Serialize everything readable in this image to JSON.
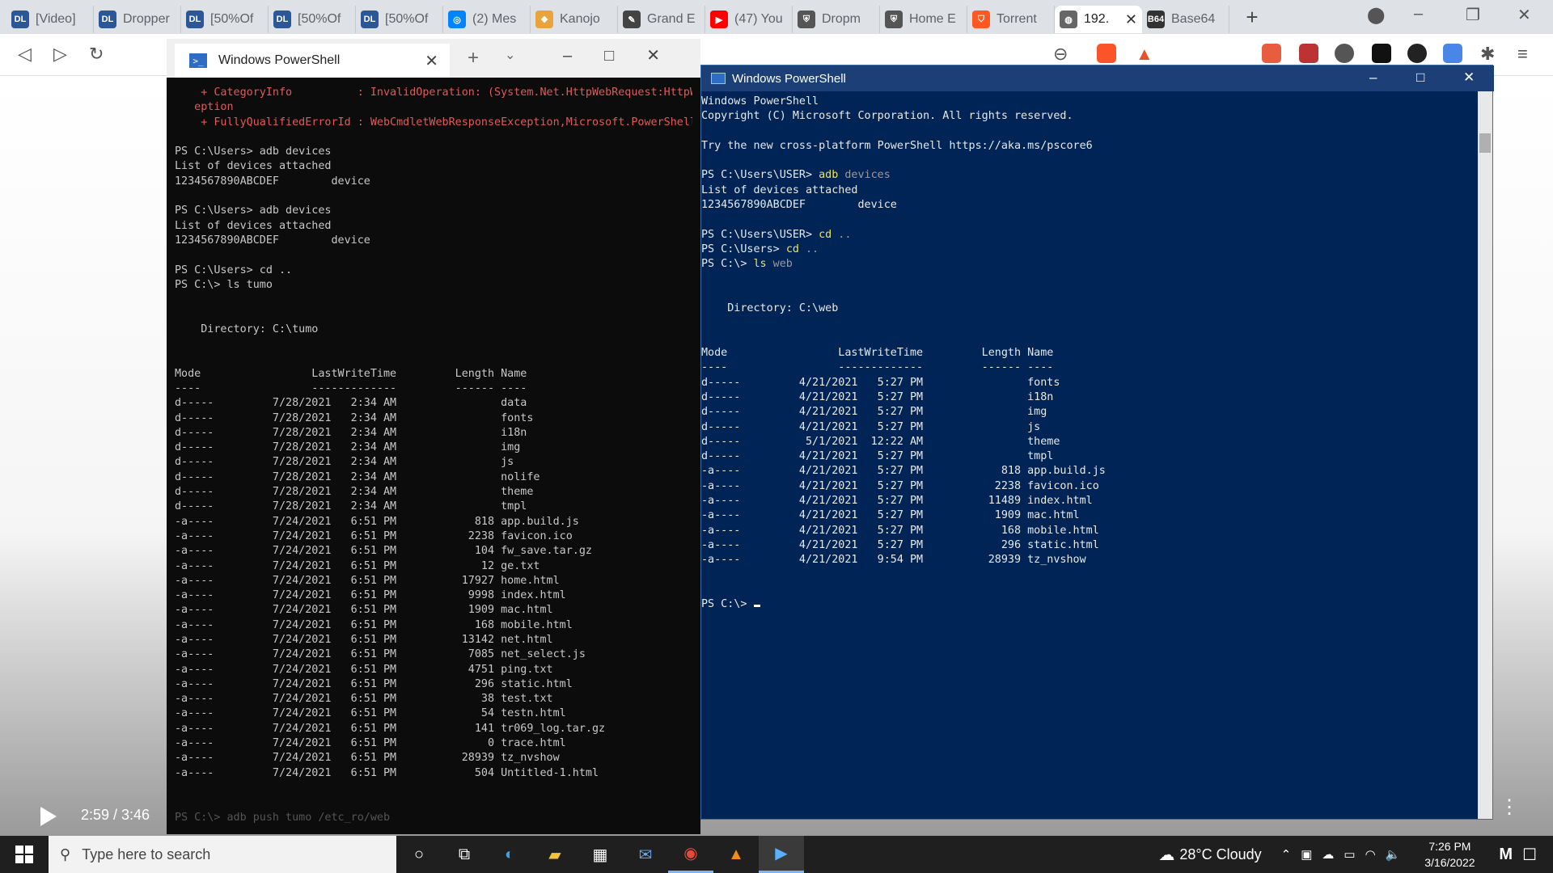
{
  "browser": {
    "tabs": [
      {
        "icon": "DL",
        "icon_color": "#2b5797",
        "label": "[Video]"
      },
      {
        "icon": "DL",
        "icon_color": "#2b5797",
        "label": "Dropper"
      },
      {
        "icon": "DL",
        "icon_color": "#2b5797",
        "label": "[50%Of"
      },
      {
        "icon": "DL",
        "icon_color": "#2b5797",
        "label": "[50%Of"
      },
      {
        "icon": "DL",
        "icon_color": "#2b5797",
        "label": "[50%Of"
      },
      {
        "icon": "◎",
        "icon_color": "#0084ff",
        "label": "(2) Mes"
      },
      {
        "icon": "❖",
        "icon_color": "#e8a33d",
        "label": "Kanojo"
      },
      {
        "icon": "✎",
        "icon_color": "#444444",
        "label": "Grand E"
      },
      {
        "icon": "▶",
        "icon_color": "#ff0000",
        "label": "(47) You"
      },
      {
        "icon": "⛨",
        "icon_color": "#555555",
        "label": "Dropm"
      },
      {
        "icon": "⛨",
        "icon_color": "#555555",
        "label": "Home E"
      },
      {
        "icon": "⛉",
        "icon_color": "#ff5722",
        "label": "Torrent"
      },
      {
        "icon": "◍",
        "icon_color": "#666666",
        "label": "192."
      },
      {
        "icon": "B64",
        "icon_color": "#333333",
        "label": "Base64"
      }
    ],
    "new_tab": "+"
  },
  "left_terminal": {
    "tab_title": "Windows PowerShell",
    "tab_icon": "powershell-icon",
    "lines": [
      {
        "t": "    + CategoryInfo          : InvalidOperation: (System.Net.HttpWebRequest:HttpWebRequest) [Invoke-WebRequest], WebExc",
        "c": "err"
      },
      {
        "t": "   eption",
        "c": "err"
      },
      {
        "t": "    + FullyQualifiedErrorId : WebCmdletWebResponseException,Microsoft.PowerShell.Commands.InvokeWebRequestCommand",
        "c": "err"
      },
      {
        "t": "",
        "c": ""
      },
      {
        "t": "PS C:\\Users> adb devices",
        "c": ""
      },
      {
        "t": "List of devices attached",
        "c": ""
      },
      {
        "t": "1234567890ABCDEF        device",
        "c": ""
      },
      {
        "t": "",
        "c": ""
      },
      {
        "t": "PS C:\\Users> adb devices",
        "c": ""
      },
      {
        "t": "List of devices attached",
        "c": ""
      },
      {
        "t": "1234567890ABCDEF        device",
        "c": ""
      },
      {
        "t": "",
        "c": ""
      },
      {
        "t": "PS C:\\Users> cd ..",
        "c": ""
      },
      {
        "t": "PS C:\\> ls tumo",
        "c": ""
      },
      {
        "t": "",
        "c": ""
      },
      {
        "t": "",
        "c": ""
      },
      {
        "t": "    Directory: C:\\tumo",
        "c": ""
      },
      {
        "t": "",
        "c": ""
      },
      {
        "t": "",
        "c": ""
      },
      {
        "t": "Mode                 LastWriteTime         Length Name",
        "c": ""
      },
      {
        "t": "----                 -------------         ------ ----",
        "c": ""
      },
      {
        "t": "d-----         7/28/2021   2:34 AM                data",
        "c": ""
      },
      {
        "t": "d-----         7/28/2021   2:34 AM                fonts",
        "c": ""
      },
      {
        "t": "d-----         7/28/2021   2:34 AM                i18n",
        "c": ""
      },
      {
        "t": "d-----         7/28/2021   2:34 AM                img",
        "c": ""
      },
      {
        "t": "d-----         7/28/2021   2:34 AM                js",
        "c": ""
      },
      {
        "t": "d-----         7/28/2021   2:34 AM                nolife",
        "c": ""
      },
      {
        "t": "d-----         7/28/2021   2:34 AM                theme",
        "c": ""
      },
      {
        "t": "d-----         7/28/2021   2:34 AM                tmpl",
        "c": ""
      },
      {
        "t": "-a----         7/24/2021   6:51 PM            818 app.build.js",
        "c": ""
      },
      {
        "t": "-a----         7/24/2021   6:51 PM           2238 favicon.ico",
        "c": ""
      },
      {
        "t": "-a----         7/24/2021   6:51 PM            104 fw_save.tar.gz",
        "c": ""
      },
      {
        "t": "-a----         7/24/2021   6:51 PM             12 ge.txt",
        "c": ""
      },
      {
        "t": "-a----         7/24/2021   6:51 PM          17927 home.html",
        "c": ""
      },
      {
        "t": "-a----         7/24/2021   6:51 PM           9998 index.html",
        "c": ""
      },
      {
        "t": "-a----         7/24/2021   6:51 PM           1909 mac.html",
        "c": ""
      },
      {
        "t": "-a----         7/24/2021   6:51 PM            168 mobile.html",
        "c": ""
      },
      {
        "t": "-a----         7/24/2021   6:51 PM          13142 net.html",
        "c": ""
      },
      {
        "t": "-a----         7/24/2021   6:51 PM           7085 net_select.js",
        "c": ""
      },
      {
        "t": "-a----         7/24/2021   6:51 PM           4751 ping.txt",
        "c": ""
      },
      {
        "t": "-a----         7/24/2021   6:51 PM            296 static.html",
        "c": ""
      },
      {
        "t": "-a----         7/24/2021   6:51 PM             38 test.txt",
        "c": ""
      },
      {
        "t": "-a----         7/24/2021   6:51 PM             54 testn.html",
        "c": ""
      },
      {
        "t": "-a----         7/24/2021   6:51 PM            141 tr069_log.tar.gz",
        "c": ""
      },
      {
        "t": "-a----         7/24/2021   6:51 PM              0 trace.html",
        "c": ""
      },
      {
        "t": "-a----         7/24/2021   6:51 PM          28939 tz_nvshow",
        "c": ""
      },
      {
        "t": "-a----         7/24/2021   6:51 PM            504 Untitled-1.html",
        "c": ""
      },
      {
        "t": "",
        "c": ""
      },
      {
        "t": "",
        "c": ""
      },
      {
        "t": "PS C:\\> adb push tumo /etc_ro/web",
        "c": "dim"
      }
    ]
  },
  "right_terminal": {
    "title": "Windows PowerShell",
    "lines": [
      {
        "t": "Windows PowerShell"
      },
      {
        "t": "Copyright (C) Microsoft Corporation. All rights reserved."
      },
      {
        "t": ""
      },
      {
        "t": "Try the new cross-platform PowerShell https://aka.ms/pscore6"
      },
      {
        "t": ""
      },
      {
        "t": "PS C:\\Users\\USER> ",
        "cmd": "adb",
        "arg": " devices"
      },
      {
        "t": "List of devices attached"
      },
      {
        "t": "1234567890ABCDEF        device"
      },
      {
        "t": ""
      },
      {
        "t": "PS C:\\Users\\USER> ",
        "cmd": "cd",
        "arg": " .."
      },
      {
        "t": "PS C:\\Users> ",
        "cmd": "cd",
        "arg": " .."
      },
      {
        "t": "PS C:\\> ",
        "cmd": "ls",
        "arg": " web"
      },
      {
        "t": ""
      },
      {
        "t": ""
      },
      {
        "t": "    Directory: C:\\web"
      },
      {
        "t": ""
      },
      {
        "t": ""
      },
      {
        "t": "Mode                 LastWriteTime         Length Name"
      },
      {
        "t": "----                 -------------         ------ ----"
      },
      {
        "t": "d-----         4/21/2021   5:27 PM                fonts"
      },
      {
        "t": "d-----         4/21/2021   5:27 PM                i18n"
      },
      {
        "t": "d-----         4/21/2021   5:27 PM                img"
      },
      {
        "t": "d-----         4/21/2021   5:27 PM                js"
      },
      {
        "t": "d-----          5/1/2021  12:22 AM                theme"
      },
      {
        "t": "d-----         4/21/2021   5:27 PM                tmpl"
      },
      {
        "t": "-a----         4/21/2021   5:27 PM            818 app.build.js"
      },
      {
        "t": "-a----         4/21/2021   5:27 PM           2238 favicon.ico"
      },
      {
        "t": "-a----         4/21/2021   5:27 PM          11489 index.html"
      },
      {
        "t": "-a----         4/21/2021   5:27 PM           1909 mac.html"
      },
      {
        "t": "-a----         4/21/2021   5:27 PM            168 mobile.html"
      },
      {
        "t": "-a----         4/21/2021   5:27 PM            296 static.html"
      },
      {
        "t": "-a----         4/21/2021   9:54 PM          28939 tz_nvshow"
      },
      {
        "t": ""
      },
      {
        "t": ""
      },
      {
        "t": "PS C:\\> "
      }
    ]
  },
  "video": {
    "time": "2:59 / 3:46"
  },
  "taskbar": {
    "search_placeholder": "Type here to search",
    "weather": "28°C  Cloudy",
    "time": "7:26 PM",
    "date": "3/16/2022"
  },
  "colors": {
    "ps_blue": "#012456",
    "console_black": "#0c0c0c",
    "accent": "#7fb3f3"
  }
}
